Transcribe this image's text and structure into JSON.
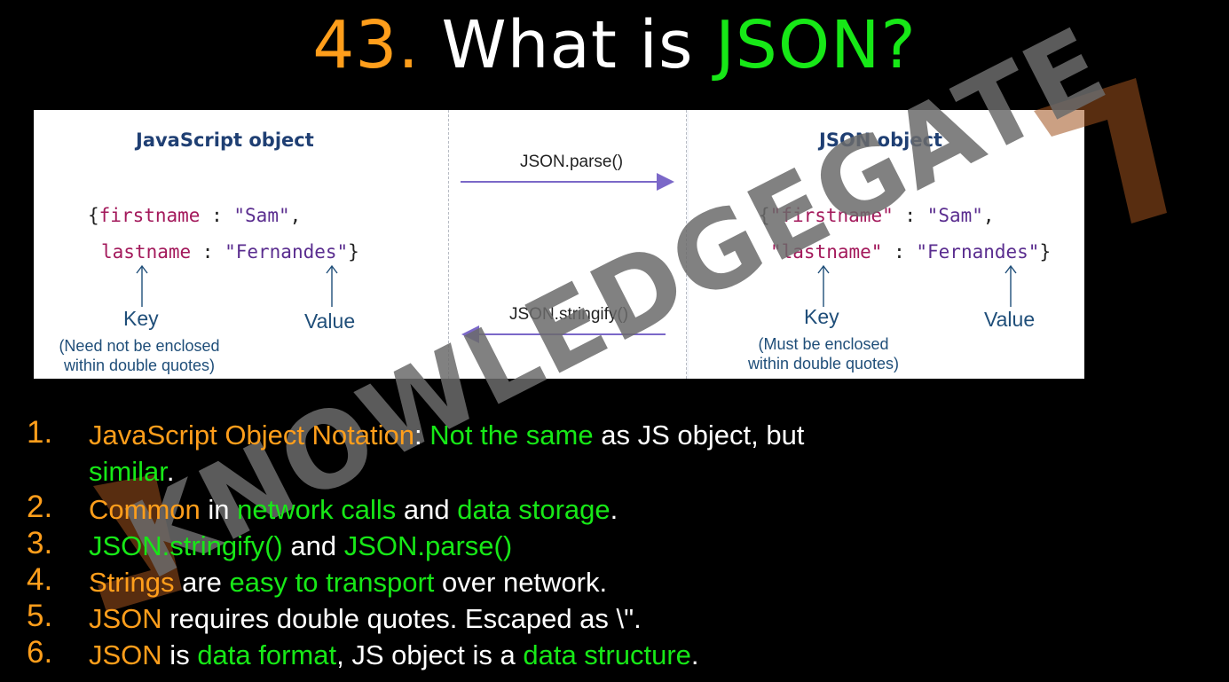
{
  "title": {
    "number": "43.",
    "text_white": "What is",
    "text_green": "JSON?"
  },
  "diagram": {
    "left_title": "JavaScript object",
    "right_title": "JSON object",
    "parse_label": "JSON.parse()",
    "stringify_label": "JSON.stringify()",
    "left_code": {
      "open_brace": "{",
      "key1": "firstname",
      "sep1": " : ",
      "val1": "\"Sam\"",
      "comma": ",",
      "key2": "lastname",
      "sep2": " : ",
      "val2": "\"Fernandes\"",
      "close_brace": "}"
    },
    "right_code": {
      "open_brace": "{",
      "key1": "\"firstname\"",
      "sep1": " : ",
      "val1": "\"Sam\"",
      "comma": ",",
      "key2": "\"lastname\"",
      "sep2": " : ",
      "val2": "\"Fernandes\"",
      "close_brace": "}"
    },
    "left_key_label": "Key",
    "left_key_note_1": "(Need not be enclosed",
    "left_key_note_2": "within double quotes)",
    "left_value_label": "Value",
    "right_key_label": "Key",
    "right_key_note_1": "(Must be enclosed",
    "right_key_note_2": "within double quotes)",
    "right_value_label": "Value"
  },
  "watermark": {
    "text": "KNOWLEDGEGATE"
  },
  "points": [
    {
      "num": "1.",
      "segs": [
        {
          "t": "JavaScript Object Notation",
          "c": "orange"
        },
        {
          "t": ": ",
          "c": "white"
        },
        {
          "t": "Not the same",
          "c": "green"
        },
        {
          "t": " as JS object, but",
          "c": "white"
        },
        {
          "t": "\n",
          "c": "br"
        },
        {
          "t": "similar",
          "c": "green"
        },
        {
          "t": ".",
          "c": "white"
        }
      ]
    },
    {
      "num": "2.",
      "segs": [
        {
          "t": "Common",
          "c": "orange"
        },
        {
          "t": " in ",
          "c": "white"
        },
        {
          "t": "network calls",
          "c": "green"
        },
        {
          "t": " and ",
          "c": "white"
        },
        {
          "t": "data storage",
          "c": "green"
        },
        {
          "t": ".",
          "c": "white"
        }
      ]
    },
    {
      "num": "3.",
      "segs": [
        {
          "t": "JSON.stringify()",
          "c": "green"
        },
        {
          "t": " and ",
          "c": "white"
        },
        {
          "t": "JSON.parse()",
          "c": "green"
        }
      ]
    },
    {
      "num": "4.",
      "segs": [
        {
          "t": "Strings",
          "c": "orange"
        },
        {
          "t": " are ",
          "c": "white"
        },
        {
          "t": "easy to transport",
          "c": "green"
        },
        {
          "t": " over network.",
          "c": "white"
        }
      ]
    },
    {
      "num": "5.",
      "segs": [
        {
          "t": "JSON",
          "c": "orange"
        },
        {
          "t": " requires double quotes. Escaped as \\\".",
          "c": "white"
        }
      ]
    },
    {
      "num": "6.",
      "segs": [
        {
          "t": "JSON",
          "c": "orange"
        },
        {
          "t": " is ",
          "c": "white"
        },
        {
          "t": "data format",
          "c": "green"
        },
        {
          "t": ", JS object is a ",
          "c": "white"
        },
        {
          "t": "data structure",
          "c": "green"
        },
        {
          "t": ".",
          "c": "white"
        }
      ]
    }
  ],
  "colors": {
    "orange": "#FF9E1B",
    "green": "#17E817",
    "white": "#FFFFFF",
    "panel_title": "#1f3f73",
    "arrow": "#7b68c8"
  }
}
